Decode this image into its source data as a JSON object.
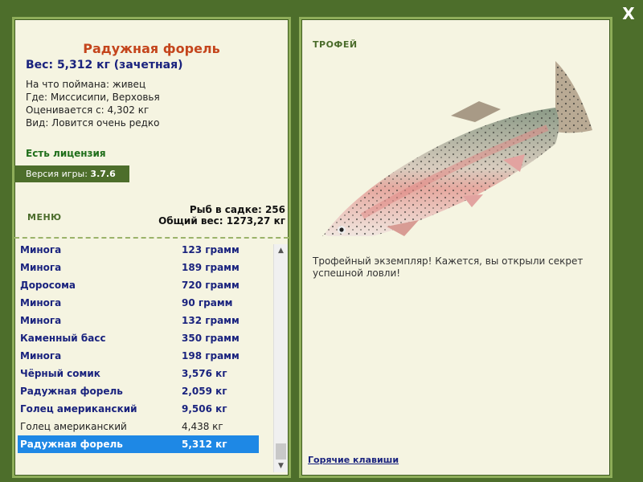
{
  "window": {
    "close_label": "X"
  },
  "catch": {
    "title": "Радужная форель",
    "weight": "Вес: 5,312 кг (зачетная)",
    "bait": "На что поймана: живец",
    "location": "Где: Миссисипи, Верховья",
    "rated_from": "Оценивается с: 4,302 кг",
    "rarity": "Вид: Ловится очень редко"
  },
  "license": "Есть лицензия",
  "version": {
    "label": "Версия игры:",
    "value": "3.7.6"
  },
  "menu_label": "МЕНЮ",
  "stats": {
    "fish_count": "Рыб в садке: 256",
    "total_weight": "Общий вес: 1273,27 кг"
  },
  "fish_list": [
    {
      "name": "Минога",
      "weight": "123 грамм"
    },
    {
      "name": "Минога",
      "weight": "189 грамм"
    },
    {
      "name": "Доросома",
      "weight": "720 грамм"
    },
    {
      "name": "Минога",
      "weight": "90 грамм"
    },
    {
      "name": "Минога",
      "weight": "132 грамм"
    },
    {
      "name": "Каменный басс",
      "weight": "350 грамм"
    },
    {
      "name": "Минога",
      "weight": "198 грамм"
    },
    {
      "name": "Чёрный сомик",
      "weight": "3,576 кг"
    },
    {
      "name": "Радужная форель",
      "weight": "2,059 кг"
    },
    {
      "name": "Голец американский",
      "weight": "9,506 кг"
    },
    {
      "name": "Голец американский",
      "weight": "4,438 кг"
    },
    {
      "name": "Радужная форель",
      "weight": "5,312 кг"
    }
  ],
  "right": {
    "trophy_label": "ТРОФЕЙ",
    "trophy_text": "Трофейный экземпляр! Кажется, вы открыли секрет успешной ловли!",
    "hotkeys": "Горячие клавиши"
  },
  "colors": {
    "frame": "#4d6e2b",
    "panel": "#f5f4e1",
    "title": "#c4451c",
    "selected": "#1e88e5",
    "bold_text": "#1a237e"
  }
}
